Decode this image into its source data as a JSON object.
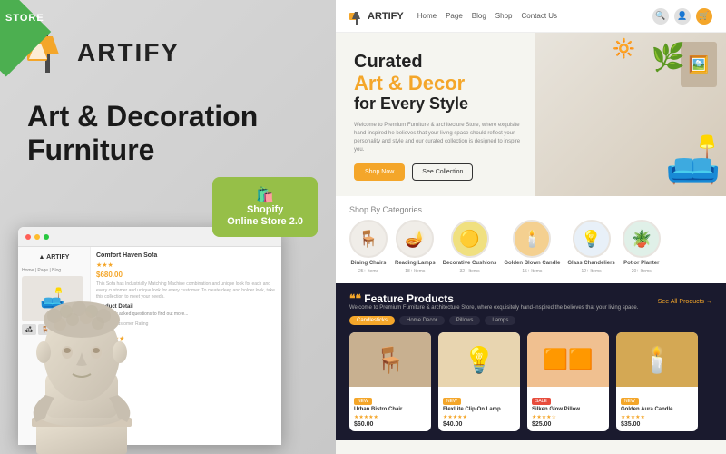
{
  "left": {
    "store_badge": "STORE",
    "brand_name": "ARTIFY",
    "title_line1": "Art & Decoration",
    "title_line2": "Furniture",
    "shopify_label": "Shopify\nOnline Store 2.0",
    "mini_product_title": "Comfort Haven Sofa",
    "mini_price": "$680.00",
    "mini_section": "Product Detail",
    "mini_rating_label": "Average Customer Rating",
    "mini_rating_value": "4.8"
  },
  "right": {
    "nav": {
      "logo": "ARTIFY",
      "links": [
        "Home",
        "Page",
        "Blog",
        "Shop",
        "Contact Us"
      ]
    },
    "hero": {
      "title_top": "Curated",
      "title_accent": "Art & Decor",
      "title_bottom": "for Every Style",
      "description": "Welcome to Premium Furniture & architecture Store, where exquisite hand-inspired he believes that your living space should reflect your personality and style and our curated collection is designed to inspire you.",
      "btn_shop": "Shop Now",
      "btn_collection": "See Collection"
    },
    "categories": {
      "label": "Shop By Categories",
      "items": [
        {
          "name": "Dining Chairs",
          "count": "25+ Items",
          "icon": "🪑"
        },
        {
          "name": "Reading Lamps",
          "count": "18+ Items",
          "icon": "🪔"
        },
        {
          "name": "Decorative Cushions",
          "count": "32+ Items",
          "icon": "🟡"
        },
        {
          "name": "Golden Blown Candle",
          "count": "15+ Items",
          "icon": "🕯️"
        },
        {
          "name": "Glass Chandeliers",
          "count": "12+ Items",
          "icon": "💡"
        },
        {
          "name": "Pot or Planter",
          "count": "20+ Items",
          "icon": "🪴"
        }
      ]
    },
    "products": {
      "title": "Feature Products",
      "subtitle": "Welcome to Premium Furniture & architecture Store, where exquisitely hand-inspired the believes that your living space.",
      "see_all": "See All Products →",
      "filters": [
        "Candlesticks",
        "Home Decor",
        "Pillows",
        "Lamps"
      ],
      "items": [
        {
          "name": "Urban Bistro Chair",
          "price": "$60.00",
          "badge": "NEW",
          "stars": "★★★★★",
          "icon": "🪑",
          "bg": "chair-bg"
        },
        {
          "name": "FlexLite Clip-On Lamp",
          "price": "$40.00",
          "badge": "NEW",
          "stars": "★★★★★",
          "icon": "💡",
          "bg": "warm-bg"
        },
        {
          "name": "Silken Glow Pillow",
          "price": "$25.00",
          "badge": "SALE",
          "stars": "★★★★☆",
          "icon": "🟧",
          "bg": "orange-bg"
        },
        {
          "name": "Golden Aura Candle",
          "price": "$35.00",
          "badge": "NEW",
          "stars": "★★★★★",
          "icon": "🕯️",
          "bg": "gold-bg"
        }
      ]
    }
  }
}
